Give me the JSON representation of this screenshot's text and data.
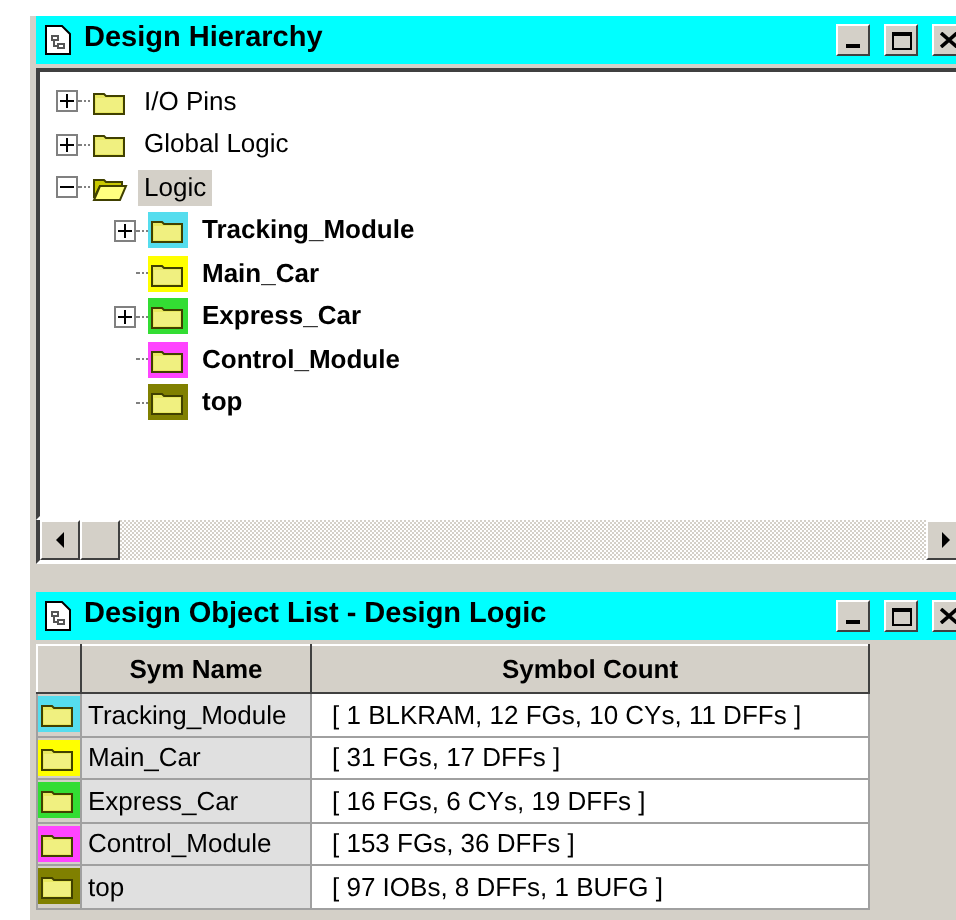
{
  "hierarchy_window": {
    "title": "Design Hierarchy",
    "tree": [
      {
        "label": "I/O Pins",
        "expandable": true,
        "expanded": false,
        "selected": false
      },
      {
        "label": "Global Logic",
        "expandable": true,
        "expanded": false,
        "selected": false
      },
      {
        "label": "Logic",
        "expandable": true,
        "expanded": true,
        "selected": true,
        "children": [
          {
            "label": "Tracking_Module",
            "color": "#55ddee",
            "expandable": true,
            "expanded": false,
            "selected": false
          },
          {
            "label": "Main_Car",
            "color": "#ffff00",
            "expandable": false,
            "expanded": false,
            "selected": false
          },
          {
            "label": "Express_Car",
            "color": "#33dd33",
            "expandable": true,
            "expanded": false,
            "selected": false
          },
          {
            "label": "Control_Module",
            "color": "#ff44ff",
            "expandable": false,
            "expanded": false,
            "selected": false
          },
          {
            "label": "top",
            "color": "#808000",
            "expandable": false,
            "expanded": false,
            "selected": false
          }
        ]
      }
    ]
  },
  "object_list_window": {
    "title": "Design Object List - Design Logic",
    "table": {
      "columns": [
        "Sym Name",
        "Symbol Count"
      ],
      "rows": [
        {
          "color": "#55ddee",
          "sym_name": "Tracking_Module",
          "symbol_count": "[ 1 BLKRAM, 12 FGs, 10 CYs, 11 DFFs ]"
        },
        {
          "color": "#ffff00",
          "sym_name": "Main_Car",
          "symbol_count": "[ 31 FGs, 17 DFFs ]"
        },
        {
          "color": "#33dd33",
          "sym_name": "Express_Car",
          "symbol_count": "[ 16 FGs, 6 CYs, 19 DFFs ]"
        },
        {
          "color": "#ff44ff",
          "sym_name": "Control_Module",
          "symbol_count": "[ 153 FGs, 36 DFFs ]"
        },
        {
          "color": "#808000",
          "sym_name": "top",
          "symbol_count": "[ 97 IOBs, 8 DFFs, 1 BUFG ]"
        }
      ]
    }
  }
}
